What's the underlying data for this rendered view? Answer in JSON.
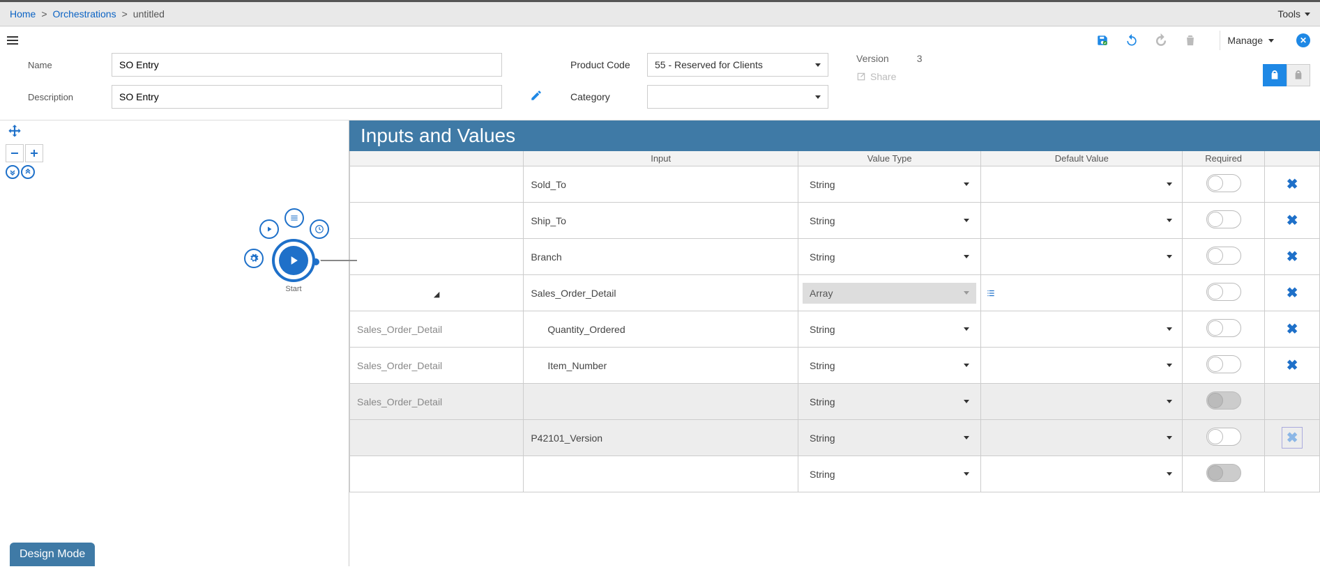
{
  "breadcrumb": {
    "home": "Home",
    "orch": "Orchestrations",
    "current": "untitled"
  },
  "tools_label": "Tools",
  "manage_label": "Manage",
  "form": {
    "name_label": "Name",
    "name_value": "SO Entry",
    "desc_label": "Description",
    "desc_value": "SO Entry",
    "product_label": "Product Code",
    "product_value": "55 - Reserved for Clients",
    "category_label": "Category",
    "category_value": "",
    "version_label": "Version",
    "version_value": "3",
    "share_label": "Share"
  },
  "canvas": {
    "start_label": "Start"
  },
  "panel": {
    "title": "Inputs and Values",
    "headers": {
      "input": "Input",
      "value_type": "Value Type",
      "default_value": "Default Value",
      "required": "Required"
    },
    "rows": [
      {
        "group": "",
        "input": "Sold_To",
        "vt": "String",
        "vt_dis": false,
        "def": "dd",
        "toggle": "off",
        "del": "x",
        "expand": ""
      },
      {
        "group": "",
        "input": "Ship_To",
        "vt": "String",
        "vt_dis": false,
        "def": "dd",
        "toggle": "off",
        "del": "x",
        "expand": ""
      },
      {
        "group": "",
        "input": "Branch",
        "vt": "String",
        "vt_dis": false,
        "def": "dd",
        "toggle": "off",
        "del": "x",
        "expand": ""
      },
      {
        "group": "",
        "input": "Sales_Order_Detail",
        "vt": "Array",
        "vt_dis": true,
        "def": "list",
        "toggle": "off",
        "del": "x",
        "expand": "open"
      },
      {
        "group": "Sales_Order_Detail",
        "input": "Quantity_Ordered",
        "indent": true,
        "vt": "String",
        "vt_dis": false,
        "def": "dd",
        "toggle": "off",
        "del": "x"
      },
      {
        "group": "Sales_Order_Detail",
        "input": "Item_Number",
        "indent": true,
        "vt": "String",
        "vt_dis": false,
        "def": "dd",
        "toggle": "off",
        "del": "x"
      },
      {
        "group": "Sales_Order_Detail",
        "input": "",
        "indent": false,
        "vt": "String",
        "vt_dis": false,
        "def": "dd",
        "toggle": "dis",
        "del": "",
        "hl": true
      },
      {
        "group": "",
        "input": "P42101_Version",
        "vt": "String",
        "vt_dis": false,
        "def": "dd",
        "toggle": "off",
        "del": "xbox",
        "hl": true
      },
      {
        "group": "",
        "input": "",
        "vt": "String",
        "vt_dis": false,
        "def": "dd",
        "toggle": "dis",
        "del": ""
      }
    ]
  },
  "design_mode": "Design Mode"
}
